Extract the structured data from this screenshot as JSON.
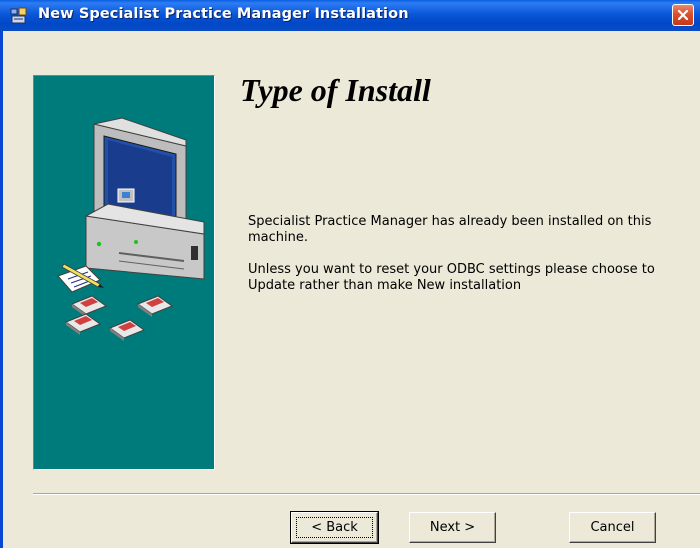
{
  "window": {
    "title": "New Specialist Practice Manager Installation",
    "title_bar_color": "#0054e3",
    "close_button_color": "#d8502e"
  },
  "side_panel": {
    "background_color": "#007b7b",
    "illustration_icon": "computer-with-disks-icon"
  },
  "content": {
    "heading": "Type of Install",
    "paragraph_1": "Specialist Practice Manager has already been installed on this machine.",
    "paragraph_2": "Unless you want to reset your ODBC settings please choose to Update rather than make New installation"
  },
  "buttons": {
    "back_label": "< Back",
    "next_label": "Next >",
    "cancel_label": "Cancel"
  }
}
